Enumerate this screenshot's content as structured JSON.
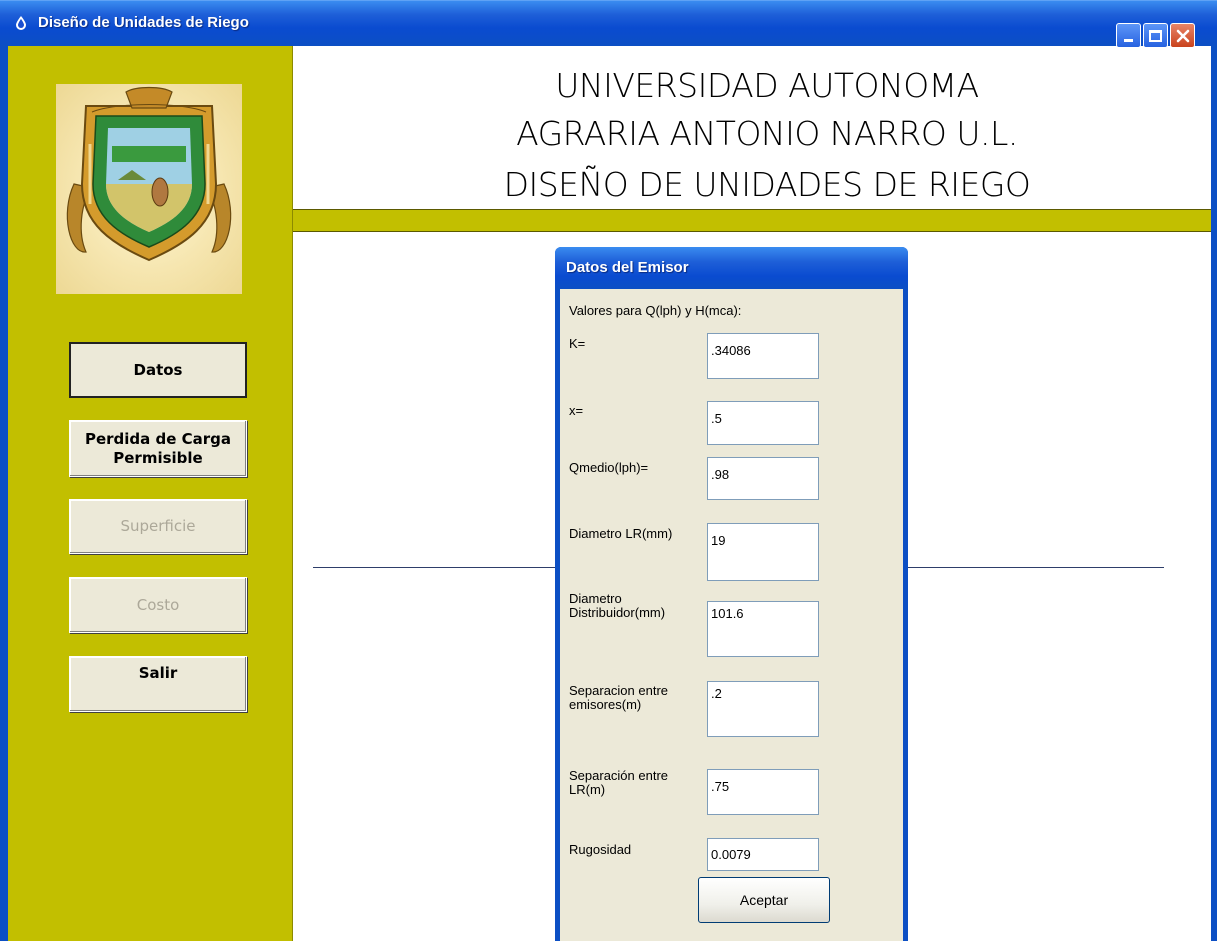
{
  "window": {
    "title": "Diseño de Unidades de Riego",
    "accent_color": "#0c4fc4",
    "panel_color": "#c2bf00"
  },
  "sidebar": {
    "logo_icon": "university-seal",
    "buttons": [
      {
        "label": "Datos",
        "state": "pressed"
      },
      {
        "label": "Perdida de Carga Permisible",
        "state": "enabled"
      },
      {
        "label": "Superficie",
        "state": "disabled"
      },
      {
        "label": "Costo",
        "state": "disabled"
      },
      {
        "label": "Salir",
        "state": "enabled"
      }
    ]
  },
  "header": {
    "line1": "UNIVERSIDAD AUTONOMA",
    "line2": "AGRARIA ANTONIO NARRO U.L.",
    "line3": "DISEÑO DE UNIDADES DE RIEGO"
  },
  "dialog": {
    "title": "Datos del Emisor",
    "intro": "Valores para Q(lph) y H(mca):",
    "fields": [
      {
        "label": "K=",
        "value": ".34086"
      },
      {
        "label": "x=",
        "value": ".5"
      },
      {
        "label": "Qmedio(lph)=",
        "value": ".98"
      },
      {
        "label": "Diametro LR(mm)",
        "value": "19"
      },
      {
        "label": "Diametro Distribuidor(mm)",
        "value": "101.6"
      },
      {
        "label": "Separacion entre emisores(m)",
        "value": ".2"
      },
      {
        "label": "Separación entre LR(m)",
        "value": ".75"
      },
      {
        "label": "Rugosidad",
        "value": "0.0079"
      }
    ],
    "accept_label": "Aceptar"
  }
}
